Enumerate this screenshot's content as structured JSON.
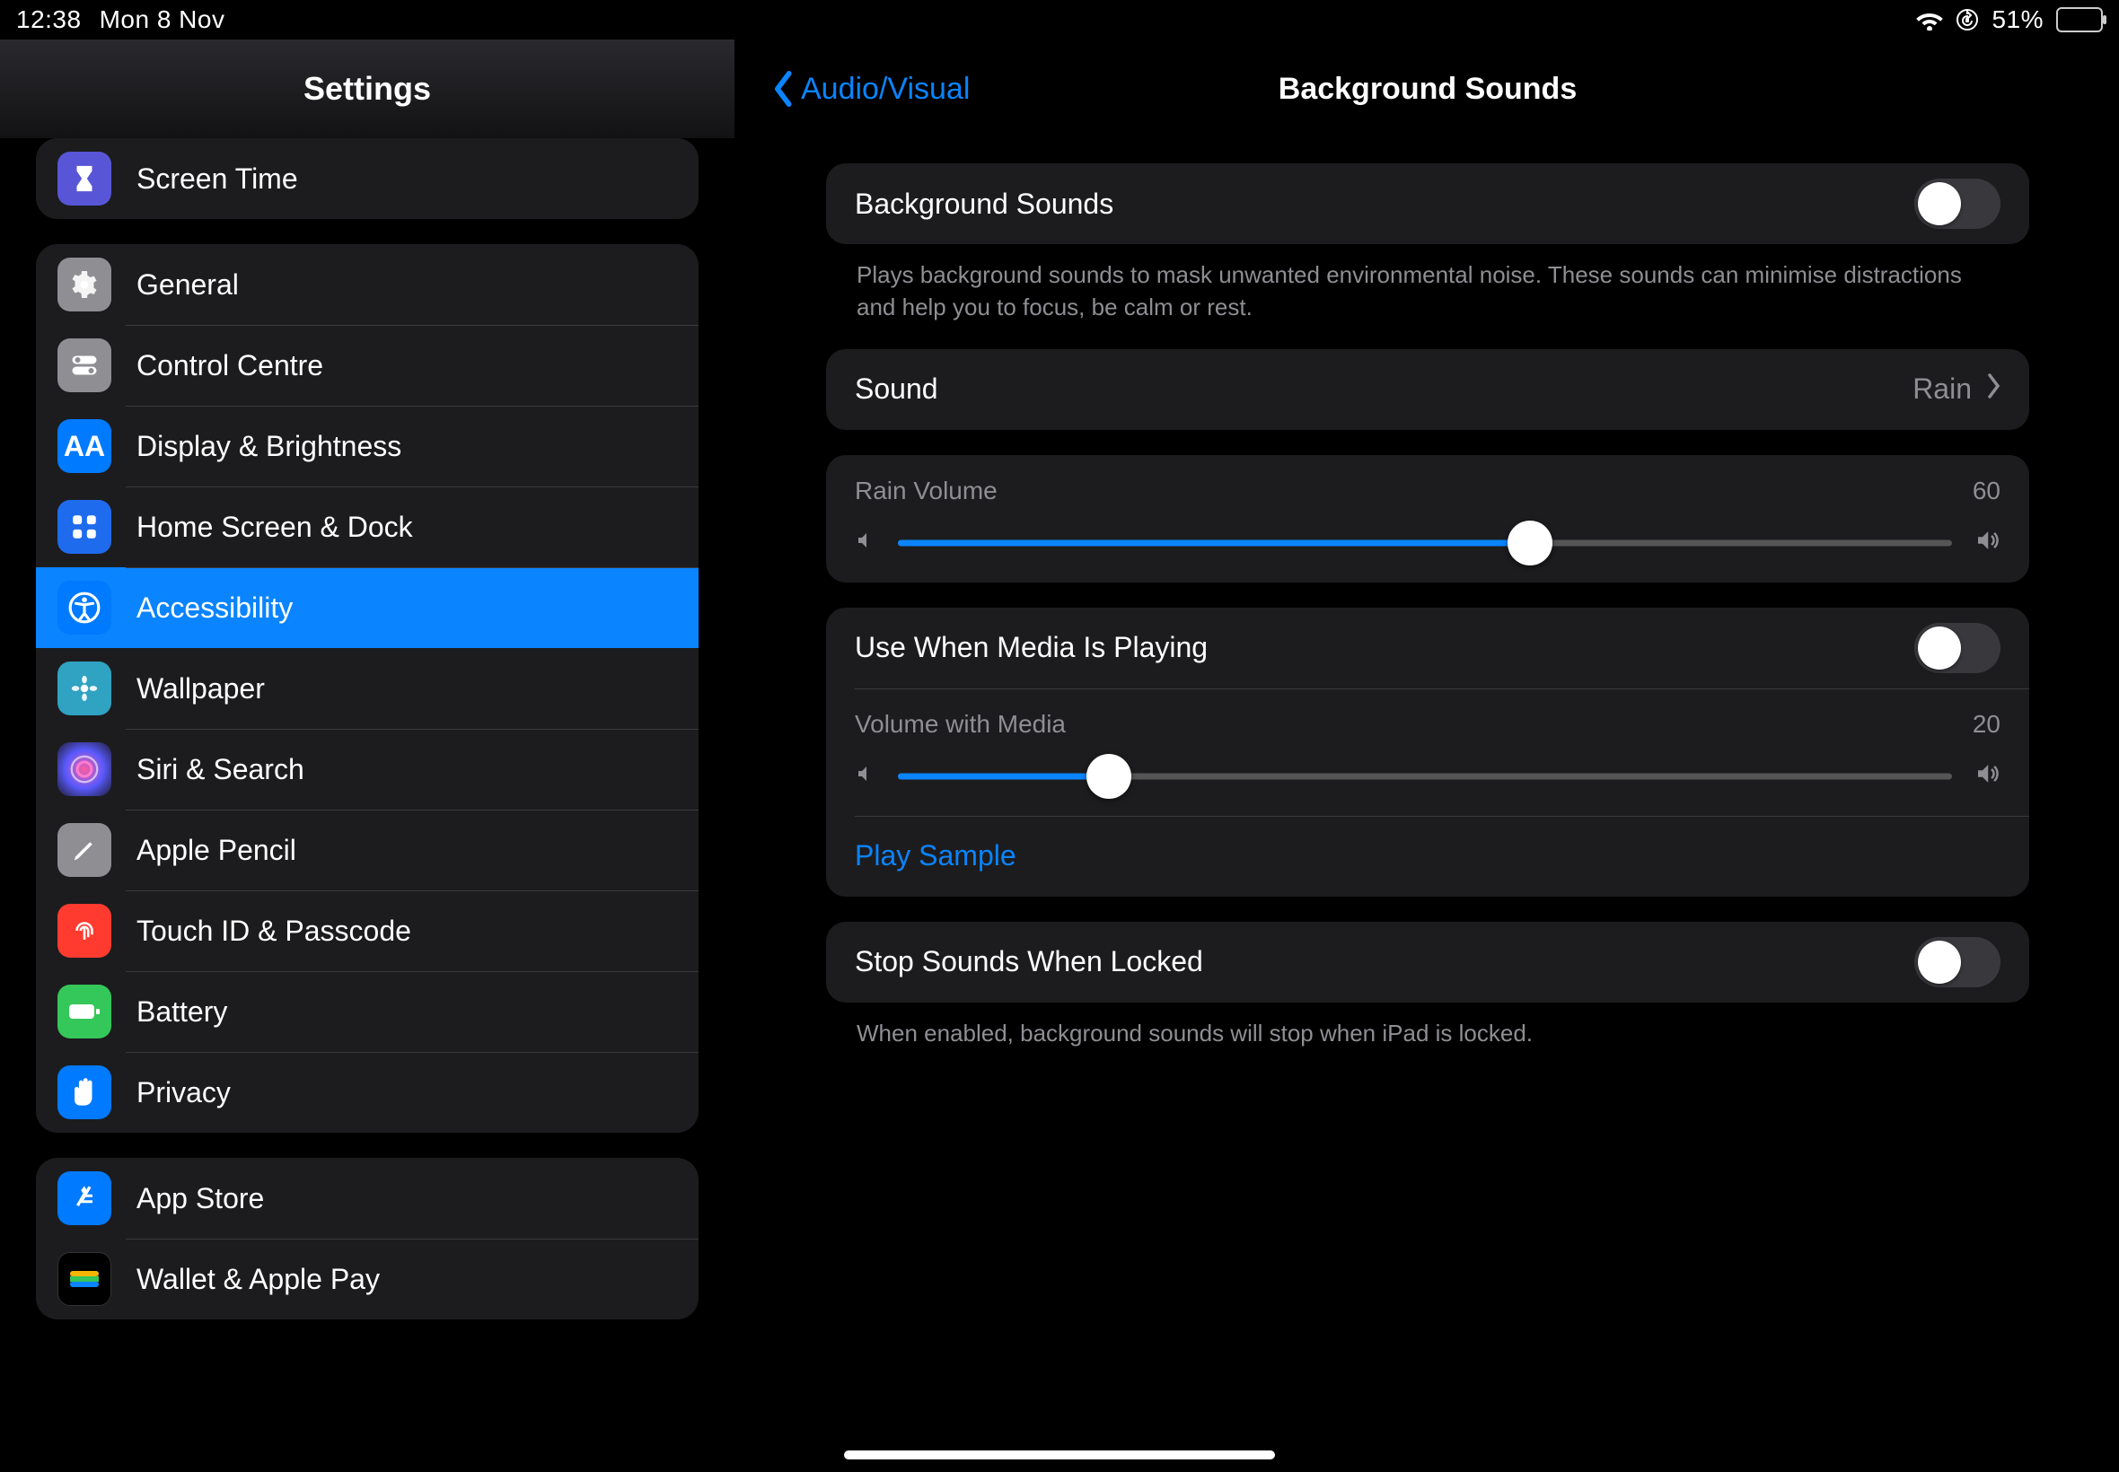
{
  "status": {
    "time": "12:38",
    "date": "Mon 8 Nov",
    "battery_pct": "51%"
  },
  "sidebar": {
    "title": "Settings",
    "groups": [
      {
        "items": [
          {
            "label": "Screen Time",
            "icon": "hourglass-icon",
            "bg": "bg-purple"
          }
        ]
      },
      {
        "items": [
          {
            "label": "General",
            "icon": "gear-icon",
            "bg": "bg-gray"
          },
          {
            "label": "Control Centre",
            "icon": "toggles-icon",
            "bg": "bg-gray"
          },
          {
            "label": "Display & Brightness",
            "icon": "aa-icon",
            "bg": "bg-blue",
            "glyph": "AA"
          },
          {
            "label": "Home Screen & Dock",
            "icon": "grid-icon",
            "bg": "bg-deepblue"
          },
          {
            "label": "Accessibility",
            "icon": "accessibility-icon",
            "bg": "bg-blue",
            "selected": true
          },
          {
            "label": "Wallpaper",
            "icon": "flower-icon",
            "bg": "bg-teal"
          },
          {
            "label": "Siri & Search",
            "icon": "siri-icon",
            "bg": "bg-grad-siri"
          },
          {
            "label": "Apple Pencil",
            "icon": "pencil-icon",
            "bg": "bg-gray"
          },
          {
            "label": "Touch ID & Passcode",
            "icon": "fingerprint-icon",
            "bg": "bg-red"
          },
          {
            "label": "Battery",
            "icon": "battery-icon",
            "bg": "bg-green"
          },
          {
            "label": "Privacy",
            "icon": "hand-icon",
            "bg": "bg-blue"
          }
        ]
      },
      {
        "items": [
          {
            "label": "App Store",
            "icon": "appstore-icon",
            "bg": "bg-blue"
          },
          {
            "label": "Wallet & Apple Pay",
            "icon": "wallet-icon",
            "bg": "bg-wallet"
          }
        ]
      }
    ]
  },
  "content": {
    "back_label": "Audio/Visual",
    "title": "Background Sounds",
    "sections": [
      {
        "cells": [
          {
            "type": "switch",
            "label": "Background Sounds",
            "on": false
          }
        ],
        "footer": "Plays background sounds to mask unwanted environmental noise. These sounds can minimise distractions and help you to focus, be calm or rest."
      },
      {
        "cells": [
          {
            "type": "nav",
            "label": "Sound",
            "value": "Rain"
          }
        ]
      },
      {
        "cells": [
          {
            "type": "slider",
            "label": "Rain Volume",
            "value": 60,
            "display": "60"
          }
        ]
      },
      {
        "cells": [
          {
            "type": "switch",
            "label": "Use When Media Is Playing",
            "on": false
          },
          {
            "type": "slider",
            "label": "Volume with Media",
            "value": 20,
            "display": "20"
          },
          {
            "type": "link",
            "label": "Play Sample"
          }
        ]
      },
      {
        "cells": [
          {
            "type": "switch",
            "label": "Stop Sounds When Locked",
            "on": false
          }
        ],
        "footer": "When enabled, background sounds will stop when iPad is locked."
      }
    ]
  }
}
